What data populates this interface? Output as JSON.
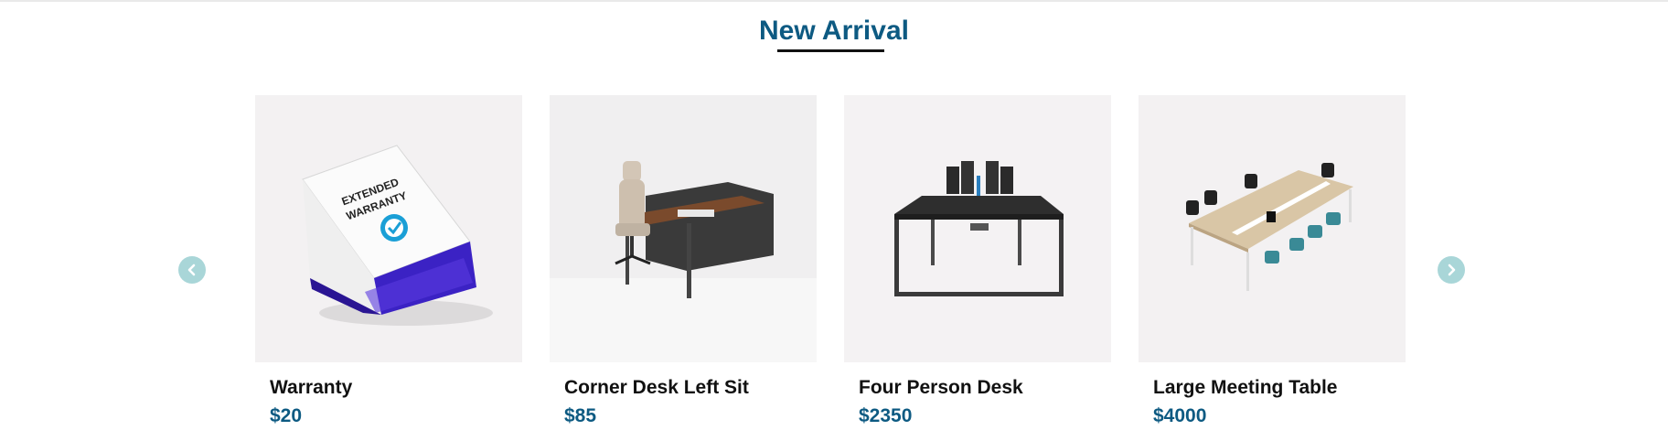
{
  "section": {
    "title": "New Arrival"
  },
  "carousel": {
    "prev_icon": "chevron-left-icon",
    "next_icon": "chevron-right-icon",
    "arrow_color": "#a9d6d8"
  },
  "products": [
    {
      "name": "Warranty",
      "price": "$20",
      "image": "extended-warranty-box",
      "box_text_line1": "EXTENDED",
      "box_text_line2": "WARRANTY"
    },
    {
      "name": "Corner Desk Left Sit",
      "price": "$85",
      "image": "corner-desk-with-chair"
    },
    {
      "name": "Four Person Desk",
      "price": "$2350",
      "image": "four-person-desk-with-monitors"
    },
    {
      "name": "Large Meeting Table",
      "price": "$4000",
      "image": "large-meeting-table-with-chairs"
    }
  ],
  "colors": {
    "accent": "#0d5a82",
    "card_bg": "#f3f1f2"
  }
}
